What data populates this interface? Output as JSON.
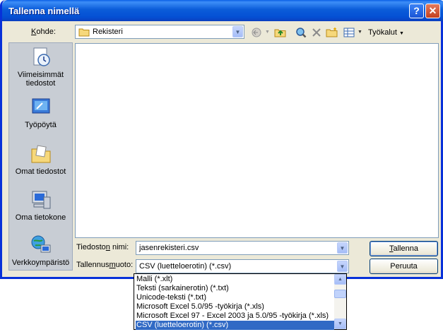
{
  "window": {
    "title": "Tallenna nimellä",
    "help_glyph": "?",
    "close_glyph": "✕"
  },
  "location": {
    "label_pre": "K",
    "label_post": "ohde:",
    "value": "Rekisteri"
  },
  "toolbar": {
    "tools_label": "Työkalut",
    "tools_underline": "y"
  },
  "places": [
    {
      "name": "recent",
      "label_line1": "Viimeisimmät",
      "label_line2": "tiedostot"
    },
    {
      "name": "desktop",
      "label_line1": "Työpöytä",
      "label_line2": ""
    },
    {
      "name": "documents",
      "label_line1": "Omat tiedostot",
      "label_line2": ""
    },
    {
      "name": "computer",
      "label_line1": "Oma tietokone",
      "label_line2": ""
    },
    {
      "name": "network",
      "label_line1": "Verkkoympäristö",
      "label_line2": ""
    }
  ],
  "filename": {
    "label_pre": "Tiedosto",
    "label_u": "n",
    "label_post": " nimi:",
    "value": "jasenrekisteri.csv"
  },
  "filetype": {
    "label_pre": "Tallennus",
    "label_u": "m",
    "label_post": "uoto:",
    "value": "CSV (luetteloerotin) (*.csv)"
  },
  "buttons": {
    "save_u": "T",
    "save_rest": "allenna",
    "cancel": "Peruuta"
  },
  "filetype_options": [
    "Malli (*.xlt)",
    "Teksti (sarkainerotin) (*.txt)",
    "Unicode-teksti (*.txt)",
    "Microsoft Excel 5.0/95 -työkirja (*.xls)",
    "Microsoft Excel 97 - Excel 2003 ja 5.0/95 -työkirja (*.xls)",
    "CSV (luetteloerotin) (*.csv)"
  ],
  "selected_option_index": 5,
  "colors": {
    "titlebar": "#0450d4",
    "selection": "#316ac5",
    "dialog_bg": "#ece9d8"
  }
}
